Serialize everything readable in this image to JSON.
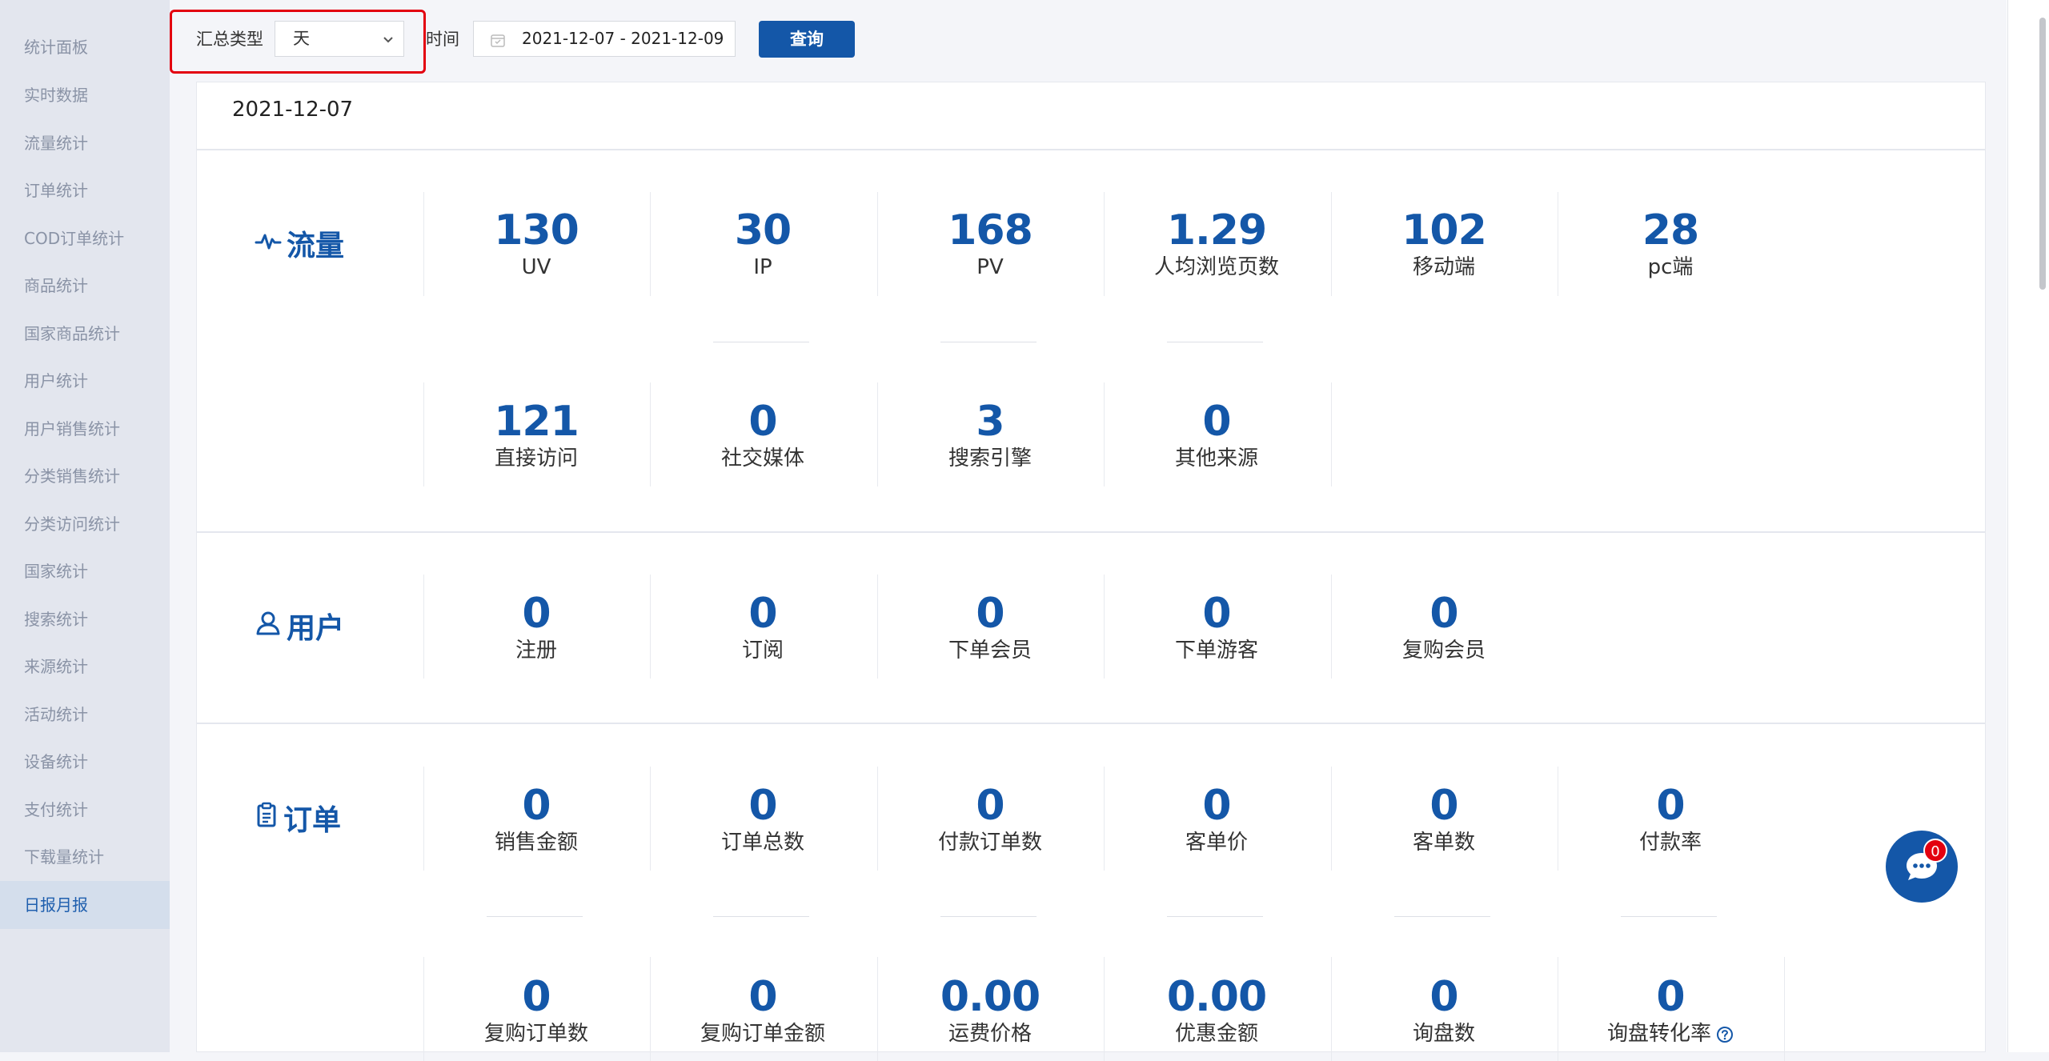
{
  "sidebar": {
    "items": [
      {
        "label": "统计面板"
      },
      {
        "label": "实时数据"
      },
      {
        "label": "流量统计"
      },
      {
        "label": "订单统计"
      },
      {
        "label": "COD订单统计"
      },
      {
        "label": "商品统计"
      },
      {
        "label": "国家商品统计"
      },
      {
        "label": "用户统计"
      },
      {
        "label": "用户销售统计"
      },
      {
        "label": "分类销售统计"
      },
      {
        "label": "分类访问统计"
      },
      {
        "label": "国家统计"
      },
      {
        "label": "搜索统计"
      },
      {
        "label": "来源统计"
      },
      {
        "label": "活动统计"
      },
      {
        "label": "设备统计"
      },
      {
        "label": "支付统计"
      },
      {
        "label": "下载量统计"
      },
      {
        "label": "日报月报",
        "active": true
      }
    ]
  },
  "toolbar": {
    "summary_type_label": "汇总类型",
    "summary_type_value": "天",
    "time_label": "时间",
    "date_range": "2021-12-07 - 2021-12-09",
    "query_button": "查询"
  },
  "report": {
    "date": "2021-12-07",
    "traffic": {
      "title": "流量",
      "icon": "pulse-icon",
      "row1": [
        {
          "value": "130",
          "label": "UV"
        },
        {
          "value": "30",
          "label": "IP"
        },
        {
          "value": "168",
          "label": "PV"
        },
        {
          "value": "1.29",
          "label": "人均浏览页数"
        },
        {
          "value": "102",
          "label": "移动端"
        },
        {
          "value": "28",
          "label": "pc端"
        }
      ],
      "row2": [
        {
          "value": "121",
          "label": "直接访问"
        },
        {
          "value": "0",
          "label": "社交媒体"
        },
        {
          "value": "3",
          "label": "搜索引擎"
        },
        {
          "value": "0",
          "label": "其他来源"
        }
      ]
    },
    "users": {
      "title": "用户",
      "icon": "user-icon",
      "row1": [
        {
          "value": "0",
          "label": "注册"
        },
        {
          "value": "0",
          "label": "订阅"
        },
        {
          "value": "0",
          "label": "下单会员"
        },
        {
          "value": "0",
          "label": "下单游客"
        },
        {
          "value": "0",
          "label": "复购会员"
        }
      ]
    },
    "orders": {
      "title": "订单",
      "icon": "clipboard-icon",
      "row1": [
        {
          "value": "0",
          "label": "销售金额"
        },
        {
          "value": "0",
          "label": "订单总数"
        },
        {
          "value": "0",
          "label": "付款订单数"
        },
        {
          "value": "0",
          "label": "客单价"
        },
        {
          "value": "0",
          "label": "客单数"
        },
        {
          "value": "0",
          "label": "付款率"
        }
      ],
      "row2": [
        {
          "value": "0",
          "label": "复购订单数"
        },
        {
          "value": "0",
          "label": "复购订单金额"
        },
        {
          "value": "0.00",
          "label": "运费价格"
        },
        {
          "value": "0.00",
          "label": "优惠金额"
        },
        {
          "value": "0",
          "label": "询盘数"
        },
        {
          "value": "0",
          "label": "询盘转化率"
        }
      ]
    }
  },
  "chat": {
    "badge": "0"
  },
  "colors": {
    "accent": "#1457a8",
    "highlight_border": "#e3000f",
    "sidebar_bg": "#e3e6ee"
  }
}
